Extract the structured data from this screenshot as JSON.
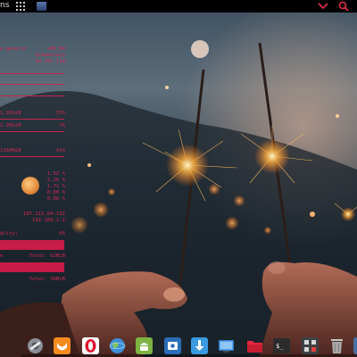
{
  "panel": {
    "apps_label": "ns",
    "icons": [
      "grid-icon",
      "window-icon",
      "chevron-down-icon",
      "search-icon"
    ],
    "accent_color": "#e0304a"
  },
  "conky": {
    "color": "#d42653",
    "lines": [
      {
        "left": "e generic",
        "right": "x86_64"
      },
      {
        "left": "",
        "right": "elementary"
      },
      {
        "left": "",
        "right": "3d 15h 11m"
      },
      {
        "left": "1.93GiB",
        "right": "33%"
      },
      {
        "left": "1.99GiB",
        "right": "7%"
      },
      {
        "left": "1160MiB",
        "right": "41%"
      },
      {
        "left": "",
        "right": "1.52 %"
      },
      {
        "left": "",
        "right": "2.26 %"
      },
      {
        "left": "",
        "right": "1.71 %"
      },
      {
        "left": "",
        "right": "0.00 %"
      },
      {
        "left": "",
        "right": "0.00 %"
      },
      {
        "left": "",
        "right": "197.111.64.132"
      },
      {
        "left": "",
        "right": "192.168.1.2"
      },
      {
        "left": "ality:",
        "right": "0%"
      },
      {
        "left": "n",
        "right": "Total: 62MiB"
      },
      {
        "left": "",
        "right": "Total: 36MiB"
      }
    ]
  },
  "dock": {
    "items": [
      {
        "name": "files-manager",
        "icon": "gear-disk-icon"
      },
      {
        "name": "firefox",
        "icon": "firefox-icon"
      },
      {
        "name": "opera",
        "icon": "opera-icon"
      },
      {
        "name": "web-browser",
        "icon": "globe-icon"
      },
      {
        "name": "android",
        "icon": "android-icon"
      },
      {
        "name": "screenshot",
        "icon": "screenshot-icon"
      },
      {
        "name": "downloads",
        "icon": "download-icon"
      },
      {
        "name": "desktop",
        "icon": "monitor-icon"
      },
      {
        "name": "file-manager",
        "icon": "folder-icon"
      },
      {
        "name": "terminal",
        "icon": "terminal-icon"
      },
      {
        "name": "calculator",
        "icon": "calculator-icon"
      },
      {
        "name": "trash",
        "icon": "trash-icon"
      },
      {
        "name": "app-extra",
        "icon": "app-icon"
      }
    ]
  }
}
